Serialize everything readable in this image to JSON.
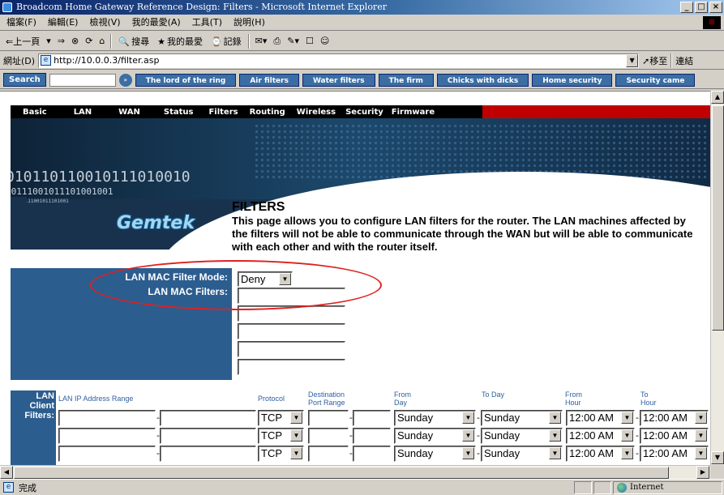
{
  "window": {
    "title": "Broadcom Home Gateway Reference Design: Filters - Microsoft Internet Explorer",
    "controls": [
      "_",
      "□",
      "×"
    ]
  },
  "menubar": {
    "items": [
      "檔案(F)",
      "編輯(E)",
      "檢視(V)",
      "我的最愛(A)",
      "工具(T)",
      "說明(H)"
    ]
  },
  "toolbar": {
    "back": "⇐上一頁",
    "forward": "⇒",
    "stop": "⊗",
    "refresh": "⟳",
    "home": "⌂",
    "search": "搜尋",
    "favorites": "我的最愛",
    "history": "記錄"
  },
  "address": {
    "label": "網址(D)",
    "url": "http://10.0.0.3/filter.asp",
    "go_label": "移至",
    "links_label": "連結"
  },
  "linksbar": {
    "search_label": "Search",
    "links": [
      "The lord of the ring",
      "Air filters",
      "Water filters",
      "The firm",
      "Chicks with dicks",
      "Home security",
      "Security came"
    ]
  },
  "nav": {
    "items": [
      "Basic",
      "LAN",
      "WAN",
      "Status",
      "Filters",
      "Routing",
      "Wireless",
      "Security",
      "Firmware"
    ]
  },
  "banner": {
    "digits_large": "010110110010111010010",
    "digits_small": "10111001011101001001",
    "digits_tiny": "0111001011101001",
    "logo": "Gemtek"
  },
  "page": {
    "title": "FILTERS",
    "intro": "This page allows you to configure LAN filters for the router. The LAN machines affected by the filters will not be able to communicate through the WAN but will be able to communicate with each other and with the router itself."
  },
  "mac_filter": {
    "mode_label": "LAN MAC Filter Mode:",
    "mode_value": "Deny",
    "filters_label": "LAN MAC Filters:"
  },
  "client_filters": {
    "section_label": "LAN Client Filters:",
    "headers": {
      "ip_range": "LAN IP Address Range",
      "protocol": "Protocol",
      "dest_port": "Destination Port Range",
      "from_day": "From Day",
      "to_day": "To Day",
      "from_hour": "From Hour",
      "to_hour": "To Hour"
    },
    "rows": [
      {
        "protocol": "TCP",
        "from_day": "Sunday",
        "to_day": "Sunday",
        "from_hour": "12:00 AM",
        "to_hour": "12:00 AM"
      },
      {
        "protocol": "TCP",
        "from_day": "Sunday",
        "to_day": "Sunday",
        "from_hour": "12:00 AM",
        "to_hour": "12:00 AM"
      },
      {
        "protocol": "TCP",
        "from_day": "Sunday",
        "to_day": "Sunday",
        "from_hour": "12:00 AM",
        "to_hour": "12:00 AM"
      }
    ]
  },
  "statusbar": {
    "text": "完成",
    "zone": "Internet"
  }
}
